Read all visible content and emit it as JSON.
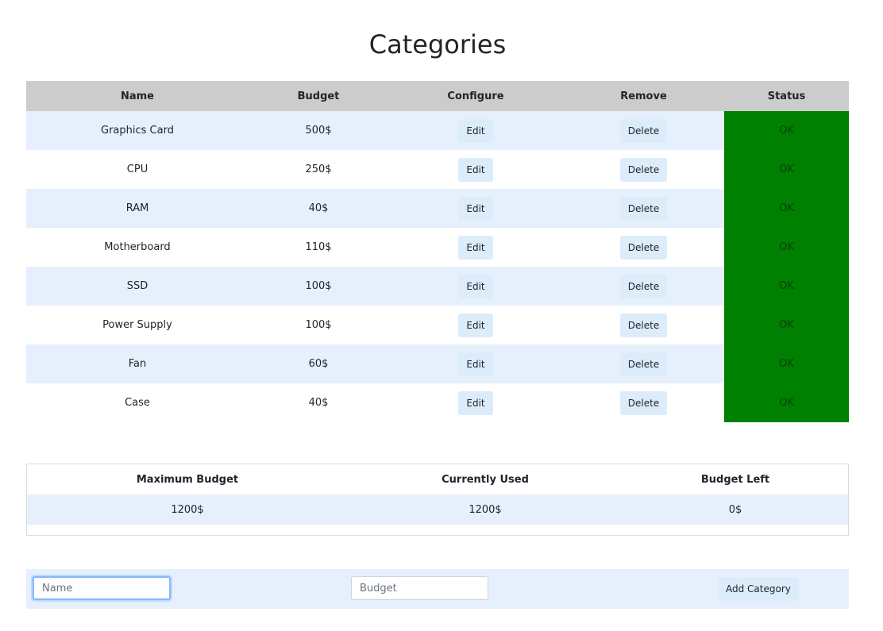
{
  "title": "Categories",
  "table": {
    "headers": [
      "Name",
      "Budget",
      "Configure",
      "Remove",
      "Status"
    ],
    "rows": [
      {
        "name": "Graphics Card",
        "budget": "500$",
        "edit": "Edit",
        "delete": "Delete",
        "status": "OK"
      },
      {
        "name": "CPU",
        "budget": "250$",
        "edit": "Edit",
        "delete": "Delete",
        "status": "OK"
      },
      {
        "name": "RAM",
        "budget": "40$",
        "edit": "Edit",
        "delete": "Delete",
        "status": "OK"
      },
      {
        "name": "Motherboard",
        "budget": "110$",
        "edit": "Edit",
        "delete": "Delete",
        "status": "OK"
      },
      {
        "name": "SSD",
        "budget": "100$",
        "edit": "Edit",
        "delete": "Delete",
        "status": "OK"
      },
      {
        "name": "Power Supply",
        "budget": "100$",
        "edit": "Edit",
        "delete": "Delete",
        "status": "OK"
      },
      {
        "name": "Fan",
        "budget": "60$",
        "edit": "Edit",
        "delete": "Delete",
        "status": "OK"
      },
      {
        "name": "Case",
        "budget": "40$",
        "edit": "Edit",
        "delete": "Delete",
        "status": "OK"
      }
    ]
  },
  "summary": {
    "headers": [
      "Maximum Budget",
      "Currently Used",
      "Budget Left"
    ],
    "values": [
      "1200$",
      "1200$",
      "0$"
    ]
  },
  "form": {
    "name_placeholder": "Name",
    "name_value": "",
    "budget_placeholder": "Budget",
    "budget_value": "",
    "add_label": "Add Category"
  },
  "colors": {
    "header_bg": "#cccccc",
    "row_alt_bg": "#e6f0fc",
    "status_ok_bg": "#008000",
    "button_bg": "#dcecfb"
  }
}
